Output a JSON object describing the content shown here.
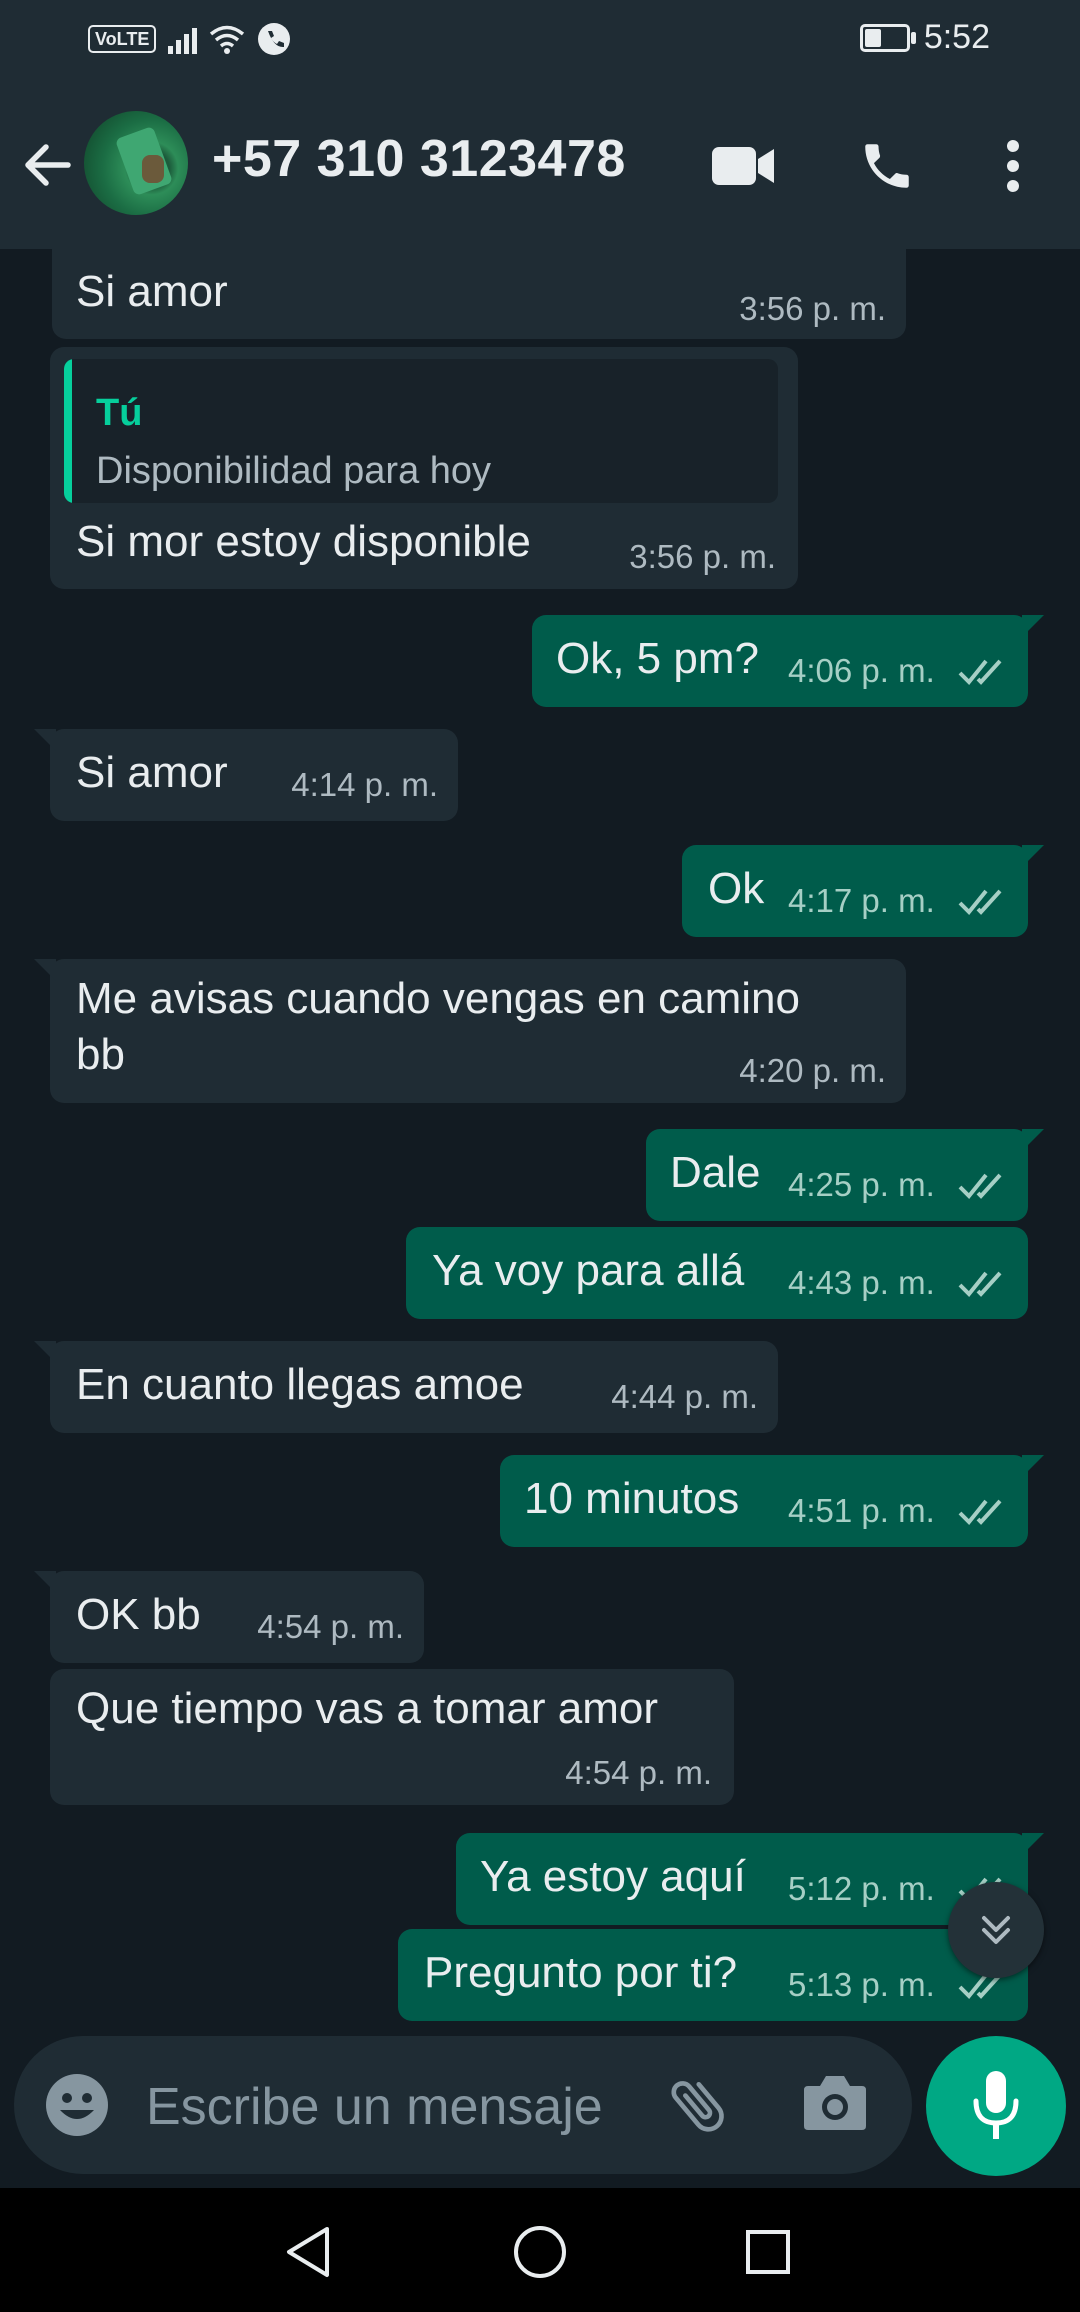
{
  "status_bar": {
    "volte": "VoLTE",
    "time": "5:52"
  },
  "header": {
    "contact": "+57 310 3123478",
    "icons": [
      "back-arrow-icon",
      "video-call-icon",
      "voice-call-icon",
      "more-vert-icon"
    ]
  },
  "messages": [
    {
      "dir": "in",
      "text": "Si amor",
      "time": "3:56 p. m."
    },
    {
      "dir": "in",
      "quote_author": "Tú",
      "quote_text": "Disponibilidad para hoy",
      "text": "Si mor estoy disponible",
      "time": "3:56 p. m."
    },
    {
      "dir": "out",
      "text": "Ok, 5 pm?",
      "time": "4:06 p. m."
    },
    {
      "dir": "in",
      "text": "Si amor",
      "time": "4:14 p. m."
    },
    {
      "dir": "out",
      "text": "Ok",
      "time": "4:17 p. m."
    },
    {
      "dir": "in",
      "text_line1": "Me avisas cuando vengas en camino",
      "text_line2": "bb",
      "time": "4:20 p. m."
    },
    {
      "dir": "out",
      "text": "Dale",
      "time": "4:25 p. m."
    },
    {
      "dir": "out",
      "text": "Ya voy para allá",
      "time": "4:43 p. m."
    },
    {
      "dir": "in",
      "text": "En cuanto llegas amoe",
      "time": "4:44 p. m."
    },
    {
      "dir": "out",
      "text": "10 minutos",
      "time": "4:51 p. m."
    },
    {
      "dir": "in",
      "text": "OK bb",
      "time": "4:54 p. m."
    },
    {
      "dir": "in",
      "text": "Que tiempo vas a tomar amor",
      "time": "4:54 p. m."
    },
    {
      "dir": "out",
      "text": "Ya estoy aquí",
      "time": "5:12 p. m."
    },
    {
      "dir": "out",
      "text": "Pregunto por ti?",
      "time": "5:13 p. m."
    }
  ],
  "compose": {
    "placeholder": "Escribe un mensaje"
  },
  "colors": {
    "background": "#121b22",
    "incoming": "#1f2c34",
    "outgoing": "#005c4b",
    "accent": "#00a884",
    "read_ticks": "#53bdeb"
  }
}
